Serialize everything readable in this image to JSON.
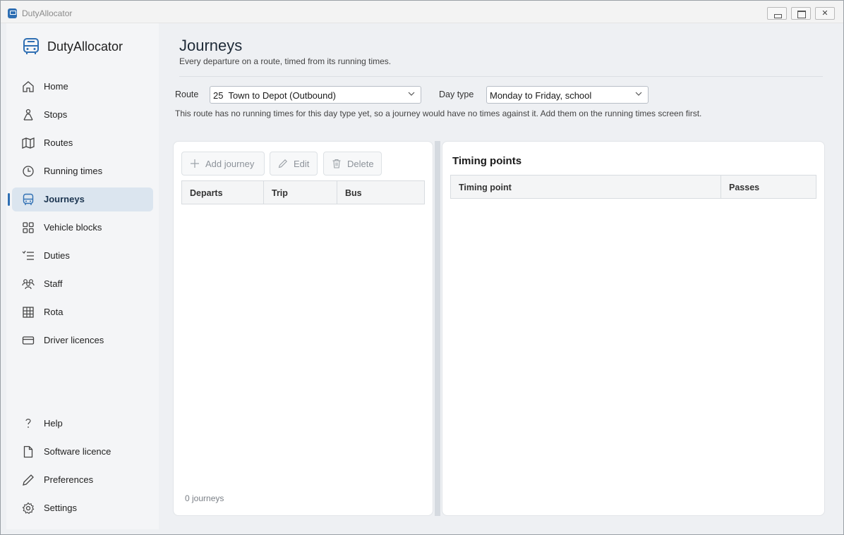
{
  "window": {
    "title": "DutyAllocator"
  },
  "sidebar": {
    "brand": "DutyAllocator",
    "items": [
      {
        "label": "Home",
        "icon": "home-icon"
      },
      {
        "label": "Stops",
        "icon": "bus-stop-icon"
      },
      {
        "label": "Routes",
        "icon": "map-icon"
      },
      {
        "label": "Running times",
        "icon": "clock-icon"
      },
      {
        "label": "Journeys",
        "icon": "bus-icon",
        "active": true
      },
      {
        "label": "Vehicle blocks",
        "icon": "grid-icon"
      },
      {
        "label": "Duties",
        "icon": "list-icon"
      },
      {
        "label": "Staff",
        "icon": "people-icon"
      },
      {
        "label": "Rota",
        "icon": "table-icon"
      },
      {
        "label": "Driver licences",
        "icon": "card-icon"
      }
    ],
    "footer_items": [
      {
        "label": "Help",
        "icon": "question-icon"
      },
      {
        "label": "Software licence",
        "icon": "document-icon"
      },
      {
        "label": "Preferences",
        "icon": "pen-icon"
      },
      {
        "label": "Settings",
        "icon": "gear-icon"
      }
    ]
  },
  "page": {
    "title": "Journeys",
    "subtitle": "Every departure on a route, timed from its running times.",
    "route_label": "Route",
    "route_value": "25  Town to Depot (Outbound)",
    "daytype_label": "Day type",
    "daytype_value": "Monday to Friday, school",
    "notice": "This route has no running times for this day type yet, so a journey would have no times against it. Add them on the running times screen first."
  },
  "journeys": {
    "toolbar": {
      "add": "Add journey",
      "edit": "Edit",
      "delete": "Delete"
    },
    "columns": [
      "Departs",
      "Trip",
      "Bus"
    ],
    "count_text": "0 journeys"
  },
  "timing": {
    "title": "Timing points",
    "columns": [
      "Timing point",
      "Passes"
    ]
  },
  "colors": {
    "accent": "#2f6fb3",
    "active_bg": "#dbe5ef"
  }
}
